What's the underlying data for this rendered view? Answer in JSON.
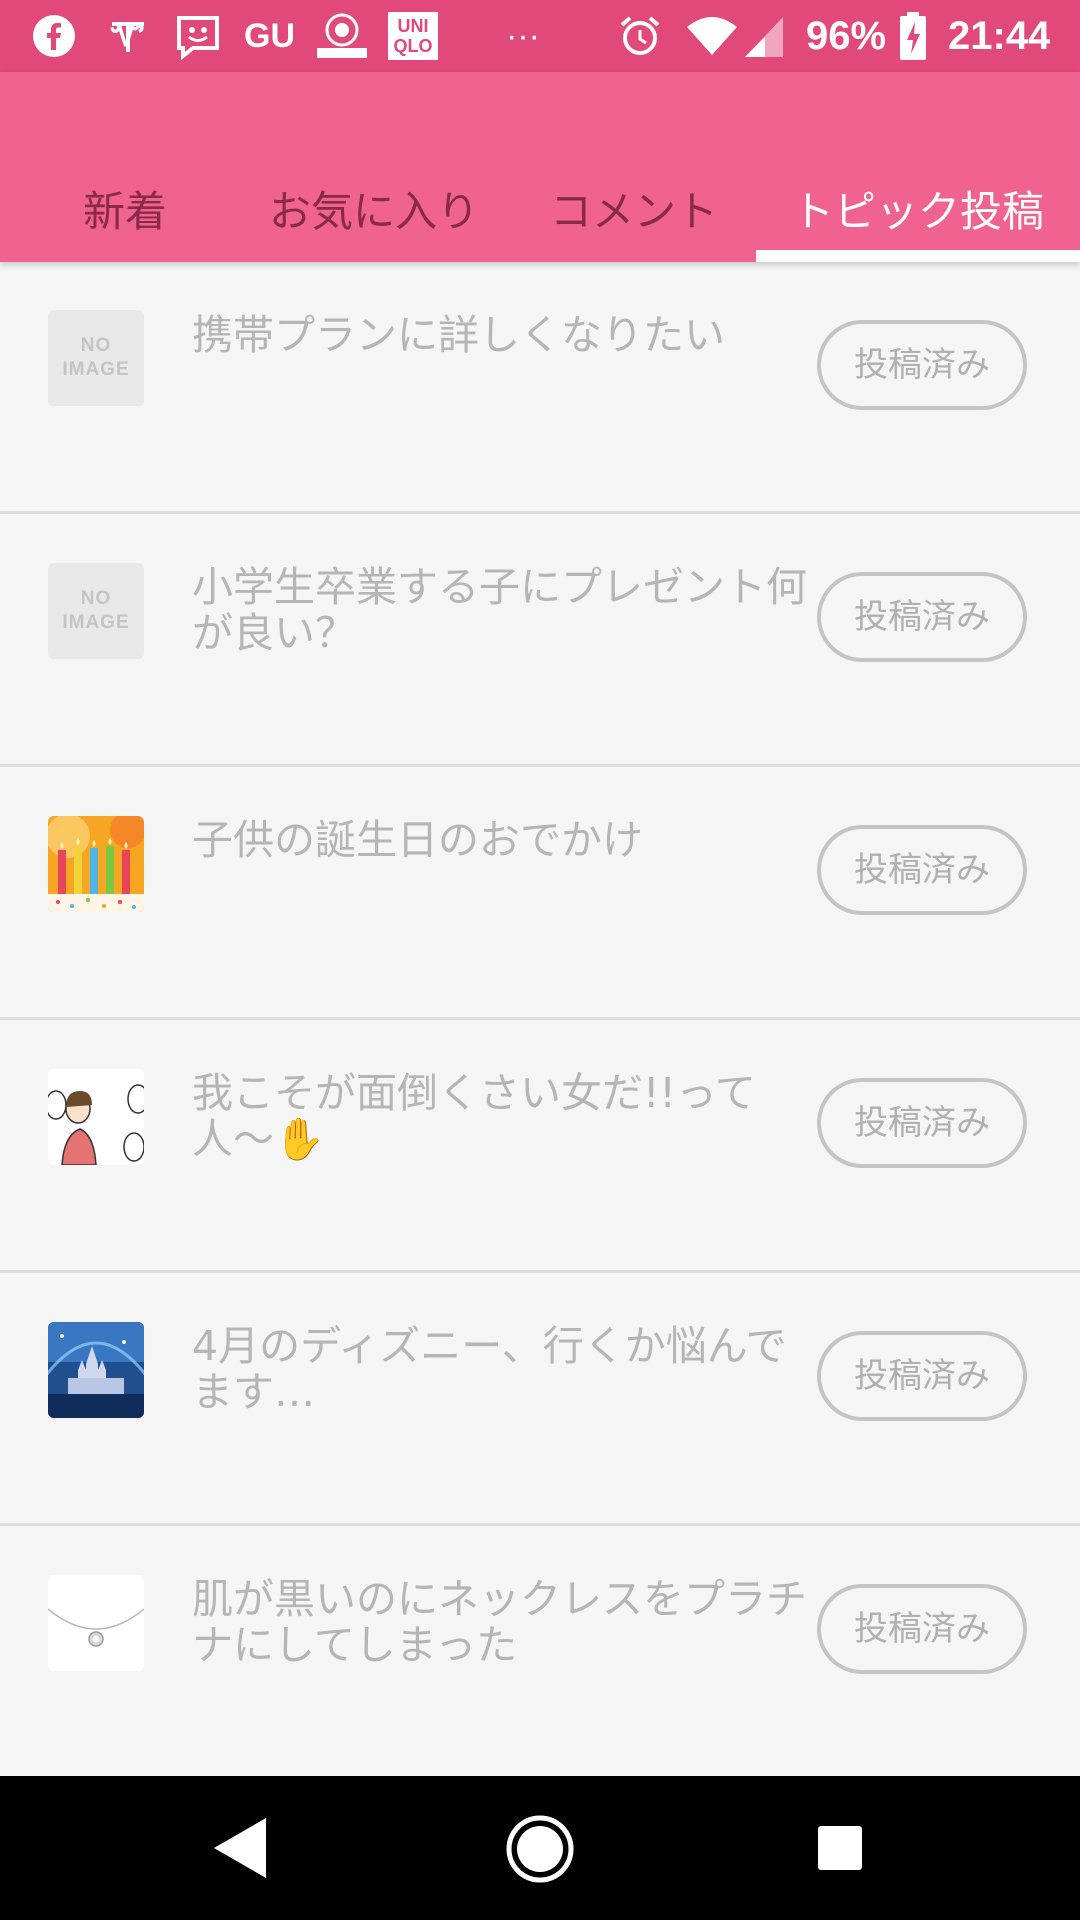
{
  "status_bar": {
    "notification_icons": [
      "facebook-icon",
      "app-icon",
      "smile-app-icon",
      "gu-icon",
      "aeon-icon",
      "uniqlo-icon",
      "more-icon"
    ],
    "gu_label": "GU",
    "uniqlo_label": "UNI\nQLO",
    "more_label": "···",
    "battery_percent": "96%",
    "time": "21:44"
  },
  "tabs": [
    {
      "label": "新着",
      "active": false
    },
    {
      "label": "お気に入り",
      "active": false
    },
    {
      "label": "コメント",
      "active": false
    },
    {
      "label": "トピック投稿",
      "active": true
    }
  ],
  "colors": {
    "status_bar": "#e0497a",
    "tab_bar": "#f06290",
    "tab_inactive_text": "#8a2a4b",
    "tab_active_text": "#ffffff",
    "background": "#f5f5f5"
  },
  "topics": [
    {
      "thumbnail": "no-image",
      "title": "携帯プランに詳しくなりたい",
      "status": "投稿済み"
    },
    {
      "thumbnail": "no-image",
      "title": "小学生卒業する子にプレゼント何が良い？",
      "status": "投稿済み"
    },
    {
      "thumbnail": "birthday-candles-image",
      "title": "子供の誕生日のおでかけ",
      "status": "投稿済み"
    },
    {
      "thumbnail": "illustration-image",
      "title": "我こそが面倒くさい女だ!!って人〜✋",
      "status": "投稿済み"
    },
    {
      "thumbnail": "castle-image",
      "title": "4月のディズニー、行くか悩んでます…",
      "status": "投稿済み"
    },
    {
      "thumbnail": "necklace-image",
      "title": "肌が黒いのにネックレスをプラチナにしてしまった",
      "status": "投稿済み"
    }
  ],
  "no_image_text": {
    "line1": "NO",
    "line2": "IMAGE"
  },
  "nav_bar": {
    "buttons": [
      "back-icon",
      "home-icon",
      "recents-icon"
    ]
  }
}
